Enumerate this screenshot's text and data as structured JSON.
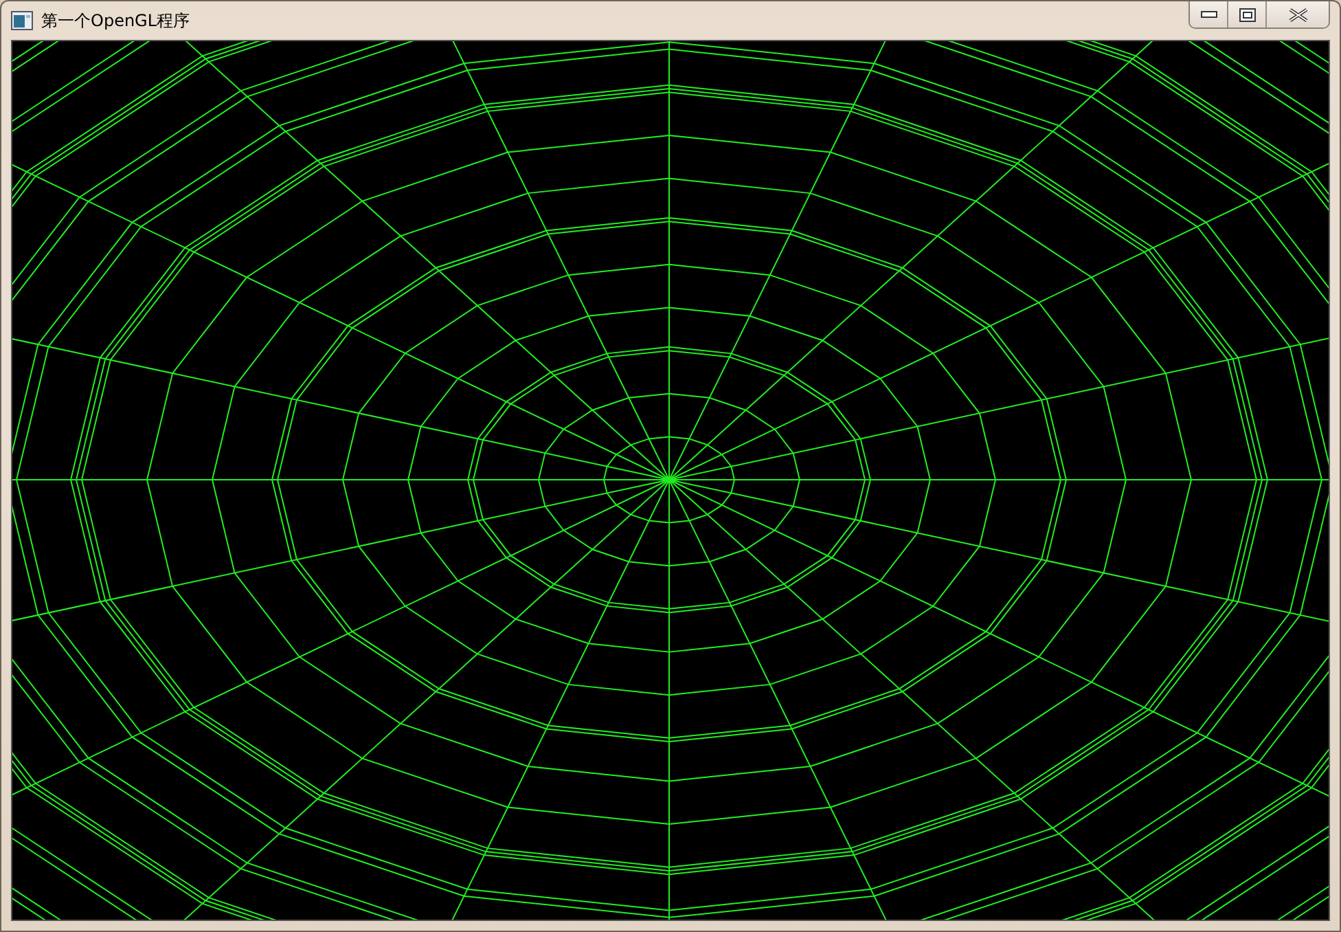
{
  "window": {
    "title": "第一个OpenGL程序"
  }
}
